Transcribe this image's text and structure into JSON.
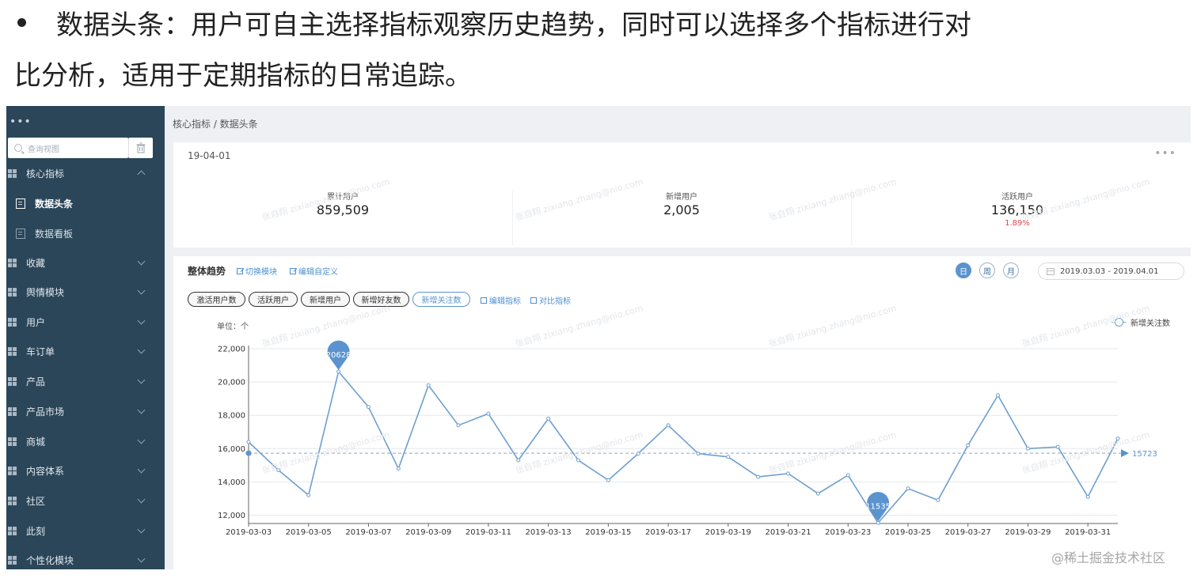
{
  "article": {
    "line1": "数据头条：用户可自主选择指标观察历史趋势，同时可以选择多个指标进行对",
    "line2": "比分析，适用于定期指标的日常追踪。"
  },
  "sidebar": {
    "dots": "•••",
    "search_placeholder": "查询视图",
    "items": [
      {
        "label": "核心指标",
        "type": "group",
        "expanded": true
      },
      {
        "label": "数据头条",
        "type": "sub",
        "active": true
      },
      {
        "label": "数据看板",
        "type": "sub",
        "active": false
      },
      {
        "label": "收藏",
        "type": "group"
      },
      {
        "label": "舆情模块",
        "type": "group"
      },
      {
        "label": "用户",
        "type": "group"
      },
      {
        "label": "车订单",
        "type": "group"
      },
      {
        "label": "产品",
        "type": "group"
      },
      {
        "label": "产品市场",
        "type": "group"
      },
      {
        "label": "商城",
        "type": "group"
      },
      {
        "label": "内容体系",
        "type": "group"
      },
      {
        "label": "社区",
        "type": "group"
      },
      {
        "label": "此刻",
        "type": "group"
      },
      {
        "label": "个性化模块",
        "type": "group"
      }
    ]
  },
  "breadcrumb": "核心指标 / 数据头条",
  "kpi": {
    "date": "19-04-01",
    "more": "•••",
    "items": [
      {
        "label": "累计用户",
        "value": "859,509",
        "change": ""
      },
      {
        "label": "新增用户",
        "value": "2,005",
        "change": ""
      },
      {
        "label": "活跃用户",
        "value": "136,150",
        "change": "1.89%"
      }
    ]
  },
  "trend": {
    "title": "整体趋势",
    "switch_link": "切换模块",
    "custom_link": "编辑自定义",
    "periods": [
      "日",
      "周",
      "月"
    ],
    "active_period": "日",
    "date_range": "2019.03.03 - 2019.04.01",
    "chips": [
      "激活用户数",
      "活跃用户",
      "新增用户",
      "新增好友数",
      "新增关注数"
    ],
    "active_chip": "新增关注数",
    "edit_metric": "编辑指标",
    "compare_metric": "对比指标",
    "unit": "单位：个"
  },
  "watermark": {
    "name": "张自翔",
    "email": "zixiang.zhang@nio.com"
  },
  "credit": "@稀土掘金技术社区",
  "colors": {
    "sidebar": "#2b4659",
    "line": "#6e9fcf",
    "accent": "#5b93cf",
    "negative": "#e0474c"
  },
  "chart_data": {
    "type": "line",
    "title": "",
    "xlabel": "",
    "ylabel": "单位：个",
    "ylim": [
      11500,
      22000
    ],
    "yticks": [
      12000,
      14000,
      16000,
      18000,
      20000,
      22000
    ],
    "ytick_labels": [
      "12,000",
      "14,000",
      "16,000",
      "18,000",
      "20,000",
      "22,000"
    ],
    "x": [
      "2019-03-03",
      "2019-03-04",
      "2019-03-05",
      "2019-03-06",
      "2019-03-07",
      "2019-03-08",
      "2019-03-09",
      "2019-03-10",
      "2019-03-11",
      "2019-03-12",
      "2019-03-13",
      "2019-03-14",
      "2019-03-15",
      "2019-03-16",
      "2019-03-17",
      "2019-03-18",
      "2019-03-19",
      "2019-03-20",
      "2019-03-21",
      "2019-03-22",
      "2019-03-23",
      "2019-03-24",
      "2019-03-25",
      "2019-03-26",
      "2019-03-27",
      "2019-03-28",
      "2019-03-29",
      "2019-03-30",
      "2019-03-31",
      "2019-04-01"
    ],
    "xtick_labels": [
      "2019-03-03",
      "2019-03-05",
      "2019-03-07",
      "2019-03-09",
      "2019-03-11",
      "2019-03-13",
      "2019-03-15",
      "2019-03-17",
      "2019-03-19",
      "2019-03-21",
      "2019-03-23",
      "2019-03-25",
      "2019-03-27",
      "2019-03-29",
      "2019-03-31"
    ],
    "series": [
      {
        "name": "新增关注数",
        "values": [
          16400,
          14700,
          13200,
          20628,
          18500,
          14800,
          19800,
          17400,
          18100,
          15300,
          17800,
          15300,
          14100,
          15700,
          17400,
          15700,
          15500,
          14300,
          14500,
          13300,
          14400,
          11535,
          13600,
          12900,
          16200,
          19200,
          16000,
          16100,
          13100,
          16600
        ]
      }
    ],
    "max_marker": {
      "label": "20628",
      "value": 20628,
      "x": "2019-03-06"
    },
    "min_marker": {
      "label": "11535",
      "value": 11535,
      "x": "2019-03-24"
    },
    "average": {
      "label": "15723",
      "value": 15723
    },
    "legend": "top-right",
    "grid": true
  }
}
